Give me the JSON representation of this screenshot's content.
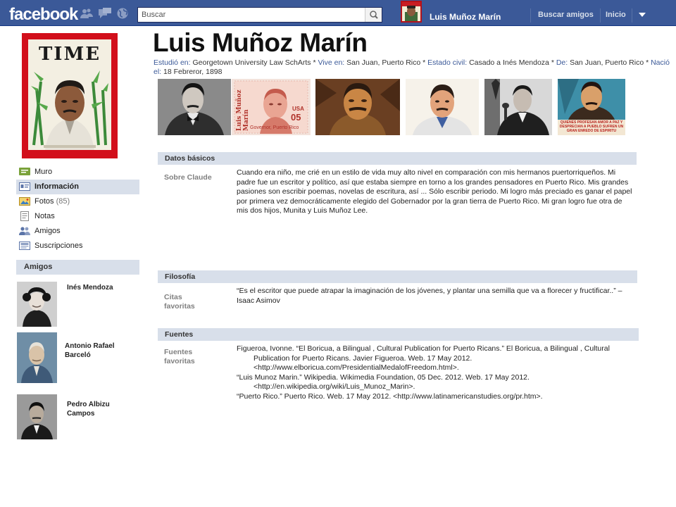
{
  "topbar": {
    "logo": "facebook",
    "search_placeholder": "Buscar",
    "user_name": "Luis Muñoz Marín",
    "find_friends": "Buscar amigos",
    "home": "Inicio",
    "bg_color": "#3b5998"
  },
  "left": {
    "cover_word": "TIME",
    "nav": [
      {
        "label": "Muro",
        "icon": "wall-icon"
      },
      {
        "label": "Información",
        "icon": "info-icon",
        "active": true
      },
      {
        "label": "Fotos",
        "count": "(85)",
        "icon": "photos-icon"
      },
      {
        "label": "Notas",
        "icon": "notes-icon"
      },
      {
        "label": "Amigos",
        "icon": "friends-icon"
      },
      {
        "label": "Suscripciones",
        "icon": "subscriptions-icon"
      }
    ],
    "friends_title": "Amigos",
    "friends": [
      {
        "name": "Inés Mendoza"
      },
      {
        "name": "Antonio Rafael Barceló"
      },
      {
        "name": "Pedro Albizu Campos"
      }
    ]
  },
  "profile": {
    "name": "Luis Muñoz Marín",
    "studied_label": "Estudió en:",
    "studied": "Georgetown University Law SchArts",
    "lives_label": "Vive en:",
    "lives": "San Juan, Puerto Rico",
    "status_label": "Estado civil:",
    "status": "Casado a Inés Mendoza",
    "from_label": "De:",
    "from": "San Juan, Puerto Rico",
    "born_label": "Nació el:",
    "born": "18 Febreror, 1898"
  },
  "sections": {
    "basic": {
      "title": "Datos básicos",
      "label": "Sobre Claude",
      "text": "Cuando era niño, me crié en un estilo de vida muy alto nivel en comparación con mis hermanos puertorriqueños. Mi padre fue un escritor y político, así que estaba siempre en torno a los grandes pensadores en Puerto Rico. Mis grandes pasiones son escribir poemas, novelas de escritura, así ... Sólo escribir periodo. Mi logro más preciado es ganar el papel por primera vez democráticamente elegido del Gobernador por la gran tierra de Puerto Rico. Mi gran logro fue otra de mis dos hijos, Munita y Luis Muñoz Lee."
    },
    "philosophy": {
      "title": "Filosofía",
      "label": "Citas favoritas",
      "text": "“Es el escritor que puede atrapar la imaginación de los jóvenes, y plantar una semilla que va a florecer y fructificar..” – Isaac Asimov"
    },
    "sources": {
      "title": "Fuentes",
      "label": "Fuentes favoritas",
      "refs": [
        "Figueroa, Ivonne. “El Boricua, a Bilingual , Cultural Publication for Puerto Ricans.” El Boricua, a Bilingual , Cultural Publication for Puerto Ricans. Javier Figueroa. Web. 17 May 2012. <http://www.elboricua.com/PresidentialMedalofFreedom.html>.",
        "“Luis Munoz Marin.” Wikipedia. Wikimedia Foundation, 05 Dec. 2012. Web. 17 May 2012. <http://en.wikipedia.org/wiki/Luis_Munoz_Marin>.",
        "“Puerto Rico.” Puerto Rico. Web. 17 May 2012. <http://www.latinamericanstudies.org/pr.htm>."
      ]
    }
  },
  "photos": {
    "stamp_text_left": "Luis Muñoz Marín",
    "stamp_usa": "USA",
    "stamp_value": "05",
    "stamp_caption": "Governor, Puerto Rico",
    "poster_text": "QUIENES PROFESAN AMOR A PAZ Y DESPRECIAN A PUEBLO SUFREN UN GRAN ENREDO DE ESPIRITU"
  }
}
